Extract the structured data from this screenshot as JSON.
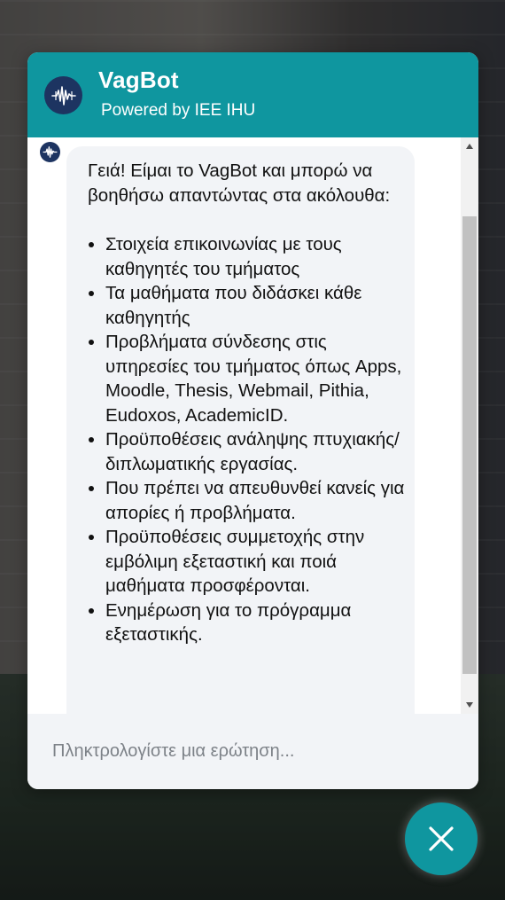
{
  "header": {
    "title": "VagBot",
    "subtitle": "Powered by IEE IHU"
  },
  "message": {
    "intro": "Γειά! Είμαι το VagBot και μπορώ να βοηθήσω απαντώντας στα ακόλουθα:",
    "items": [
      "Στοιχεία επικοινωνίας με τους καθηγητές του τμήματος",
      "Τα μαθήματα που διδάσκει κάθε καθηγητής",
      "Προβλήματα σύνδεσης στις υπηρεσίες του τμήματος όπως Apps, Moodle, Thesis, Webmail, Pithia, Eudoxos, AcademicID.",
      "Προϋποθέσεις ανάληψης πτυχιακής/διπλωματικής εργασίας.",
      "Που πρέπει να απευθυνθεί κανείς για απορίες ή προβλήματα.",
      "Προϋποθέσεις συμμετοχής στην εμβόλιμη εξεταστική και ποιά μαθήματα προσφέρονται.",
      "Ενημέρωση για το πρόγραμμα εξεταστικής."
    ]
  },
  "input": {
    "value": "",
    "placeholder": "Πληκτρολογίστε μια ερώτηση..."
  },
  "icons": {
    "avatar": "bot-waveform-icon",
    "close": "close-icon",
    "scroll_up": "arrow-up-icon",
    "scroll_down": "arrow-down-icon"
  },
  "colors": {
    "brand": "#0f969f",
    "avatar_bg": "#1d3461",
    "bubble_bg": "#f2f4f7"
  }
}
